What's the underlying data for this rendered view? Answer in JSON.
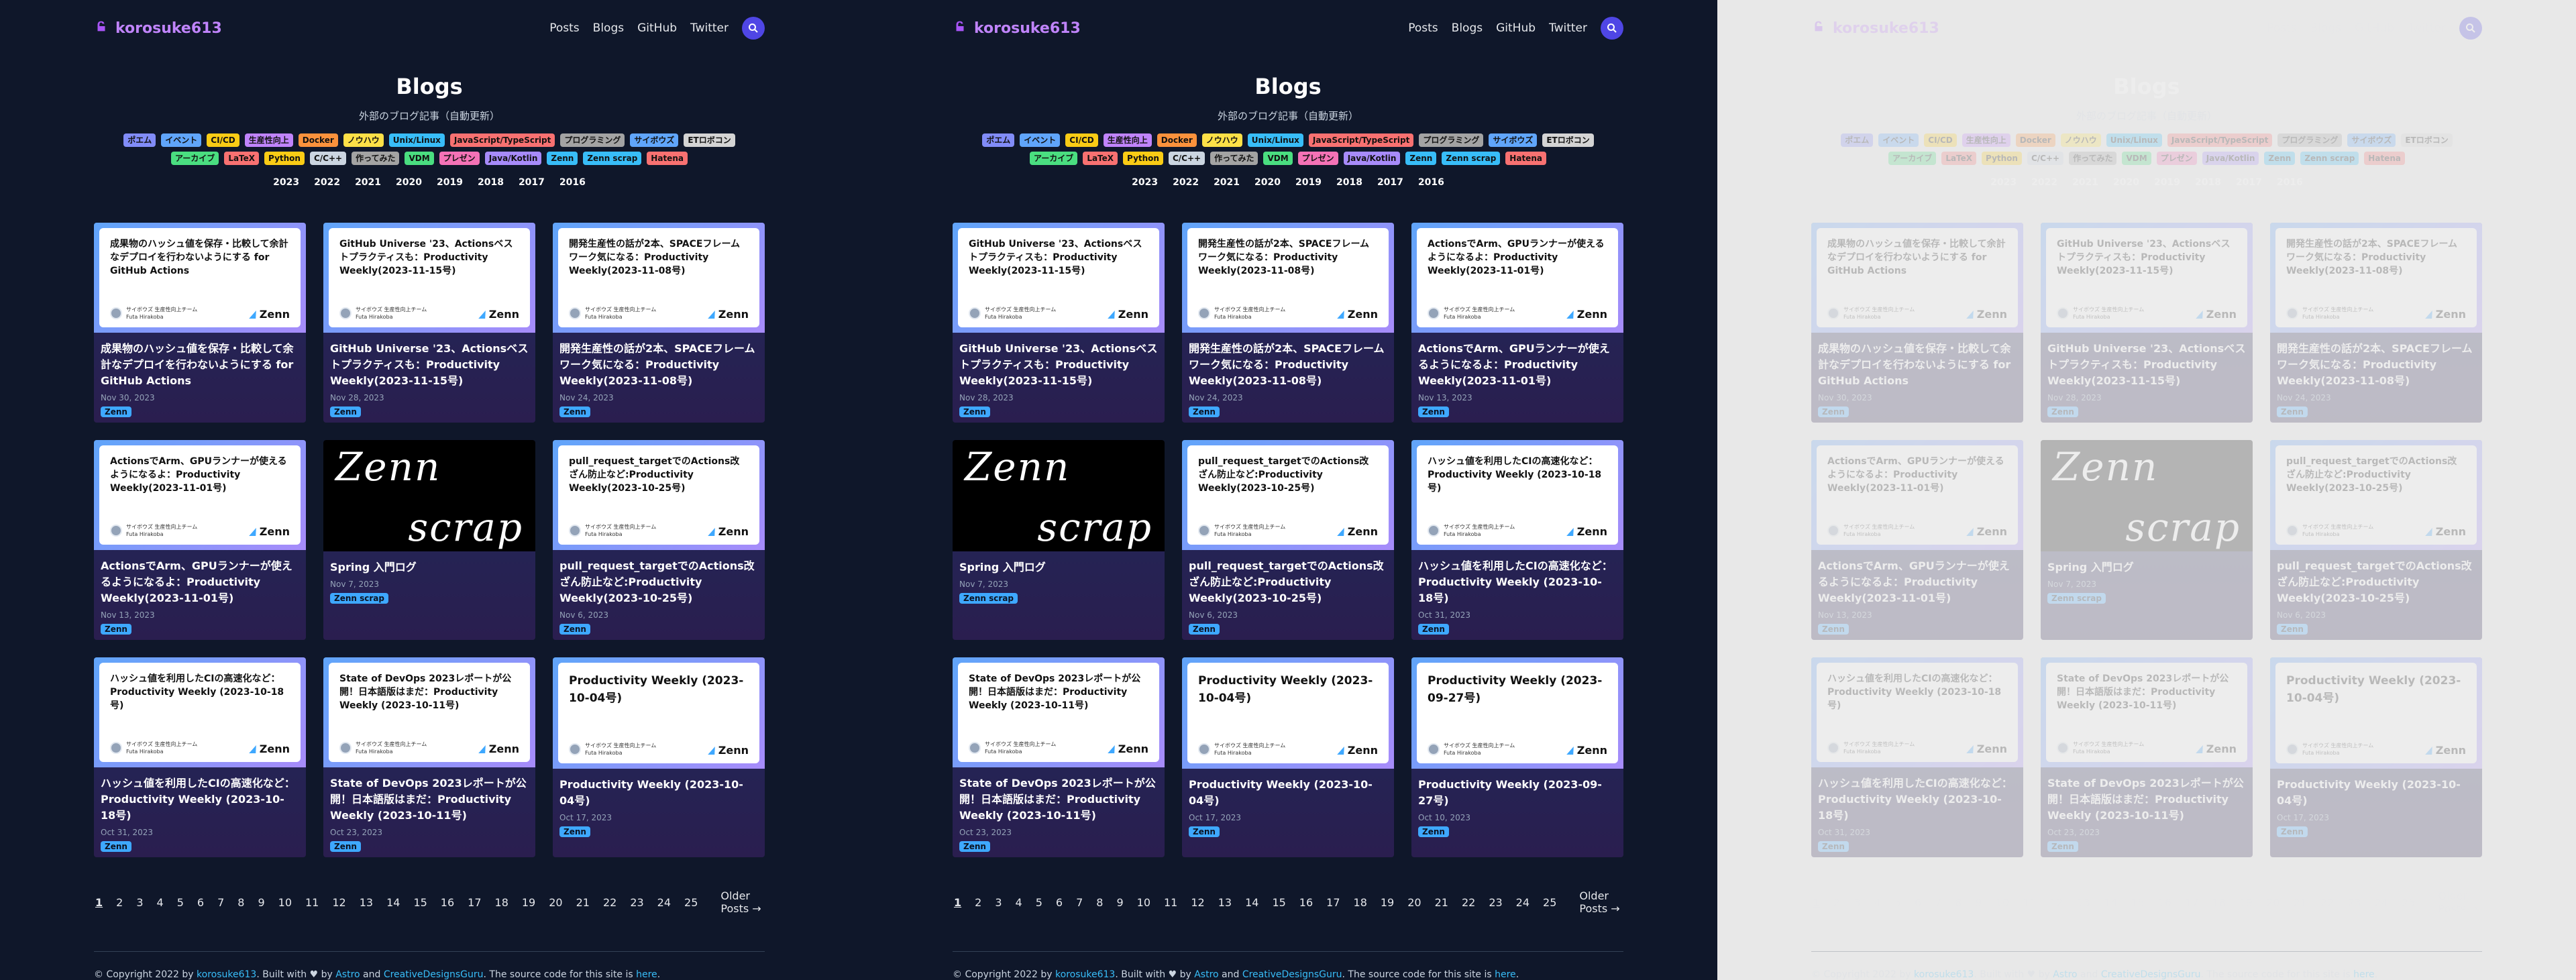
{
  "site": {
    "logo": "korosuke613",
    "nav": [
      "Posts",
      "Blogs",
      "GitHub",
      "Twitter"
    ]
  },
  "page": {
    "title": "Blogs",
    "subtitle": "外部のブログ記事（自動更新）",
    "tags": [
      {
        "label": "ポエム",
        "color": "#818cf8"
      },
      {
        "label": "イベント",
        "color": "#60a5fa"
      },
      {
        "label": "CI/CD",
        "color": "#facc15"
      },
      {
        "label": "生産性向上",
        "color": "#c084fc"
      },
      {
        "label": "Docker",
        "color": "#fb923c"
      },
      {
        "label": "ノウハウ",
        "color": "#fde047"
      },
      {
        "label": "Unix/Linux",
        "color": "#38bdf8"
      },
      {
        "label": "JavaScript/TypeScript",
        "color": "#f87171"
      },
      {
        "label": "プログラミング",
        "color": "#a3a3a3"
      },
      {
        "label": "サイボウズ",
        "color": "#60a5fa"
      },
      {
        "label": "ETロボコン",
        "color": "#d4d4d4"
      },
      {
        "label": "アーカイブ",
        "color": "#4ade80"
      },
      {
        "label": "LaTeX",
        "color": "#f87171"
      },
      {
        "label": "Python",
        "color": "#facc15"
      },
      {
        "label": "C/C++",
        "color": "#cbd5e1"
      },
      {
        "label": "作ってみた",
        "color": "#a3a3a3"
      },
      {
        "label": "VDM",
        "color": "#4ade80"
      },
      {
        "label": "プレゼン",
        "color": "#f472b6"
      },
      {
        "label": "Java/Kotlin",
        "color": "#a78bfa"
      },
      {
        "label": "Zenn",
        "color": "#38bdf8"
      },
      {
        "label": "Zenn scrap",
        "color": "#38bdf8"
      },
      {
        "label": "Hatena",
        "color": "#f87171"
      }
    ],
    "years": [
      "2023",
      "2022",
      "2021",
      "2020",
      "2019",
      "2018",
      "2017",
      "2016"
    ]
  },
  "posts": [
    {
      "title": "成果物のハッシュ値を保存・比較して余計なデプロイを行わないようにする for GitHub Actions",
      "date": "Nov 30, 2023",
      "tag": "Zenn",
      "thumb": "ogp"
    },
    {
      "title": "GitHub Universe '23、Actionsベストプラクティスも：Productivity Weekly(2023-11-15号)",
      "date": "Nov 28, 2023",
      "tag": "Zenn",
      "thumb": "ogp"
    },
    {
      "title": "開発生産性の話が2本、SPACEフレームワーク気になる：Productivity Weekly(2023-11-08号)",
      "date": "Nov 24, 2023",
      "tag": "Zenn",
      "thumb": "ogp"
    },
    {
      "title": "ActionsでArm、GPUランナーが使えるようになるよ：Productivity Weekly(2023-11-01号)",
      "date": "Nov 13, 2023",
      "tag": "Zenn",
      "thumb": "ogp"
    },
    {
      "title": "Spring 入門ログ",
      "date": "Nov 7, 2023",
      "tag": "Zenn scrap",
      "thumb": "scrap"
    },
    {
      "title": "pull_request_targetでのActions改ざん防止など:Productivity Weekly(2023-10-25号)",
      "date": "Nov 6, 2023",
      "tag": "Zenn",
      "thumb": "ogp"
    },
    {
      "title": "ハッシュ値を利用したCIの高速化など：Productivity Weekly (2023-10-18号)",
      "date": "Oct 31, 2023",
      "tag": "Zenn",
      "thumb": "ogp"
    },
    {
      "title": "State of DevOps 2023レポートが公開！日本語版はまだ：Productivity Weekly (2023-10-11号)",
      "date": "Oct 23, 2023",
      "tag": "Zenn",
      "thumb": "ogp"
    },
    {
      "title": "Productivity Weekly (2023-10-04号)",
      "date": "Oct 17, 2023",
      "tag": "Zenn",
      "thumb": "big"
    },
    {
      "title": "Productivity Weekly (2023-09-27号)",
      "date": "Oct 10, 2023",
      "tag": "Zenn",
      "thumb": "big"
    }
  ],
  "ogp": {
    "author_line": "サイボウズ 生産性向上チーム",
    "author_name": "Futa Hirakoba",
    "brand": "Zenn",
    "scrap_word1": "Zenn",
    "scrap_word2": "scrap"
  },
  "pager": {
    "pages": [
      "1",
      "2",
      "3",
      "4",
      "5",
      "6",
      "7",
      "8",
      "9",
      "10",
      "11",
      "12",
      "13",
      "14",
      "15",
      "16",
      "17",
      "18",
      "19",
      "20",
      "21",
      "22",
      "23",
      "24",
      "25"
    ],
    "current": "1",
    "older": "Older Posts →"
  },
  "footer": {
    "prefix": "© Copyright 2022 by ",
    "author": "korosuke613",
    "mid1": ". Built with ♥ by ",
    "astro": "Astro",
    "and": " and ",
    "cdg": "CreativeDesignsGuru",
    "mid2": ". The source code for this site is ",
    "here": "here",
    "end": "."
  },
  "panels": [
    {
      "variant": "dark",
      "start": 0,
      "hidden": false
    },
    {
      "variant": "dark",
      "start": 1,
      "hidden": false
    },
    {
      "variant": "ghost",
      "start": 0,
      "hidden": true
    }
  ],
  "colors": {
    "bg": "#0f172a",
    "accent": "#c084fc",
    "link": "#38bdf8",
    "zenn": "#3ea8ff"
  }
}
